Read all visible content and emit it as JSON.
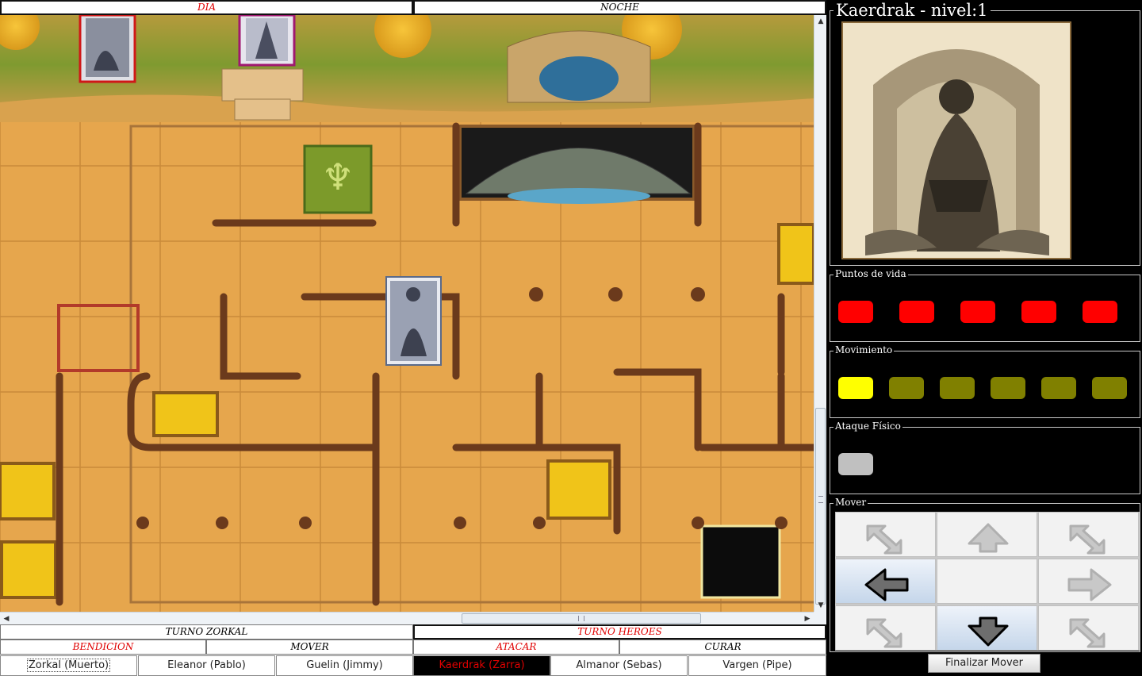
{
  "phase": {
    "day_label": "DIA",
    "night_label": "NOCHE"
  },
  "turns": {
    "zorkal_label": "TURNO ZORKAL",
    "heroes_label": "TURNO HEROES"
  },
  "actions": [
    {
      "label": "BENDICION",
      "active": true
    },
    {
      "label": "MOVER",
      "active": false
    },
    {
      "label": "ATACAR",
      "active": true
    },
    {
      "label": "CURAR",
      "active": false
    }
  ],
  "players": [
    {
      "label": "Zorkal (Muerto)",
      "current": false
    },
    {
      "label": "Eleanor (Pablo)",
      "current": false
    },
    {
      "label": "Guelin (Jimmy)",
      "current": false
    },
    {
      "label": "Kaerdrak (Zarra)",
      "current": true
    },
    {
      "label": "Almanor (Sebas)",
      "current": false
    },
    {
      "label": "Vargen (Pipe)",
      "current": false
    }
  ],
  "hero": {
    "title": "Kaerdrak - nivel:1"
  },
  "stats": {
    "life_label": "Puntos de vida",
    "life": {
      "total": 5,
      "remaining": 5,
      "color": "#ff0000"
    },
    "move_label": "Movimiento",
    "move": {
      "total": 6,
      "remaining": 1,
      "color_on": "#ffff00",
      "color_off": "#808000"
    },
    "attack_label": "Ataque Físico",
    "attack": {
      "total": 1,
      "remaining": 0,
      "color_off": "#c0c0c0"
    }
  },
  "mover": {
    "label": "Mover",
    "buttons": [
      {
        "name": "move-up-left-button",
        "icon": "diagonal-arrow-icon",
        "enabled": false
      },
      {
        "name": "move-up-button",
        "icon": "arrow-up-icon",
        "enabled": false
      },
      {
        "name": "move-up-right-button",
        "icon": "diagonal-arrow-icon",
        "enabled": false
      },
      {
        "name": "move-left-button",
        "icon": "arrow-left-icon",
        "enabled": true
      },
      {
        "name": "move-center-button",
        "icon": "",
        "enabled": false
      },
      {
        "name": "move-right-button",
        "icon": "arrow-right-icon",
        "enabled": false
      },
      {
        "name": "move-down-left-button",
        "icon": "diagonal-arrow-icon",
        "enabled": false
      },
      {
        "name": "move-down-button",
        "icon": "arrow-down-icon",
        "enabled": true
      },
      {
        "name": "move-down-right-button",
        "icon": "diagonal-arrow-icon",
        "enabled": false
      }
    ],
    "finish_label": "Finalizar Mover"
  },
  "colors": {
    "board": "#e3a44b",
    "tile_line": "#c98a3a",
    "wall": "#6b3a1c",
    "treasure": "#f0c419",
    "active_red": "#e00000"
  }
}
